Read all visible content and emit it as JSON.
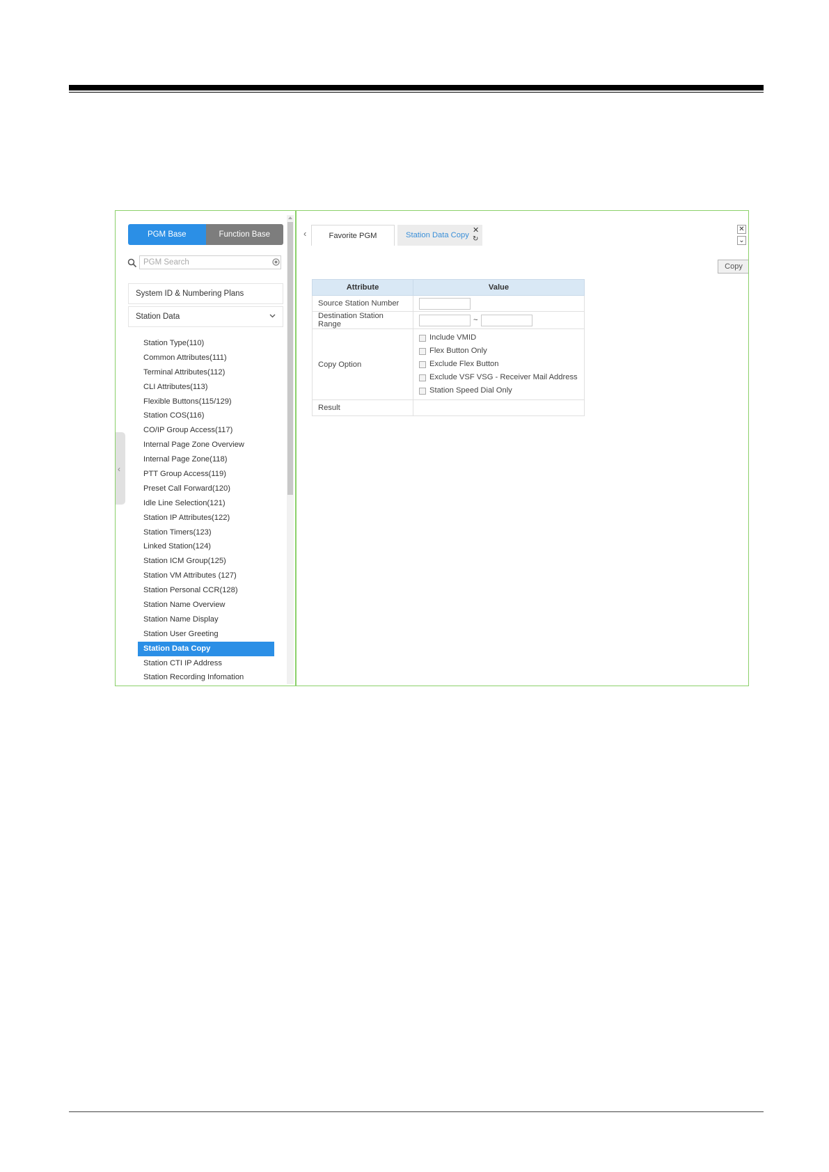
{
  "left_panel": {
    "toggle": {
      "pgm_base": "PGM Base",
      "function_base": "Function Base"
    },
    "search": {
      "placeholder": "PGM Search"
    },
    "nav": {
      "system_id": "System ID & Numbering Plans",
      "station_data": "Station Data"
    },
    "station_items": [
      "Station Type(110)",
      "Common Attributes(111)",
      "Terminal Attributes(112)",
      "CLI Attributes(113)",
      "Flexible Buttons(115/129)",
      "Station COS(116)",
      "CO/IP Group Access(117)",
      "Internal Page Zone Overview",
      "Internal Page Zone(118)",
      "PTT Group Access(119)",
      "Preset Call Forward(120)",
      "Idle Line Selection(121)",
      "Station IP Attributes(122)",
      "Station Timers(123)",
      "Linked Station(124)",
      "Station ICM Group(125)",
      "Station VM Attributes (127)",
      "Station Personal CCR(128)",
      "Station Name Overview",
      "Station Name Display",
      "Station User Greeting",
      "Station Data Copy",
      "Station CTI IP Address",
      "Station Recording Infomation"
    ],
    "selected_item": "Station Data Copy"
  },
  "tabs": {
    "favorite": "Favorite PGM",
    "active": "Station Data Copy"
  },
  "toolbar": {
    "copy_label": "Copy"
  },
  "table": {
    "header_attribute": "Attribute",
    "header_value": "Value",
    "rows": {
      "source": "Source Station Number",
      "destination": "Destination Station Range",
      "copy_option": "Copy Option",
      "result": "Result"
    },
    "range_separator": "~",
    "copy_options": [
      "Include VMID",
      "Flex Button Only",
      "Exclude Flex Button",
      "Exclude VSF VSG - Receiver Mail Address",
      "Station Speed Dial Only"
    ]
  },
  "colors": {
    "accent": "#2b8fe6",
    "frame_border": "#8bd06a",
    "table_header": "#d9e8f5"
  }
}
